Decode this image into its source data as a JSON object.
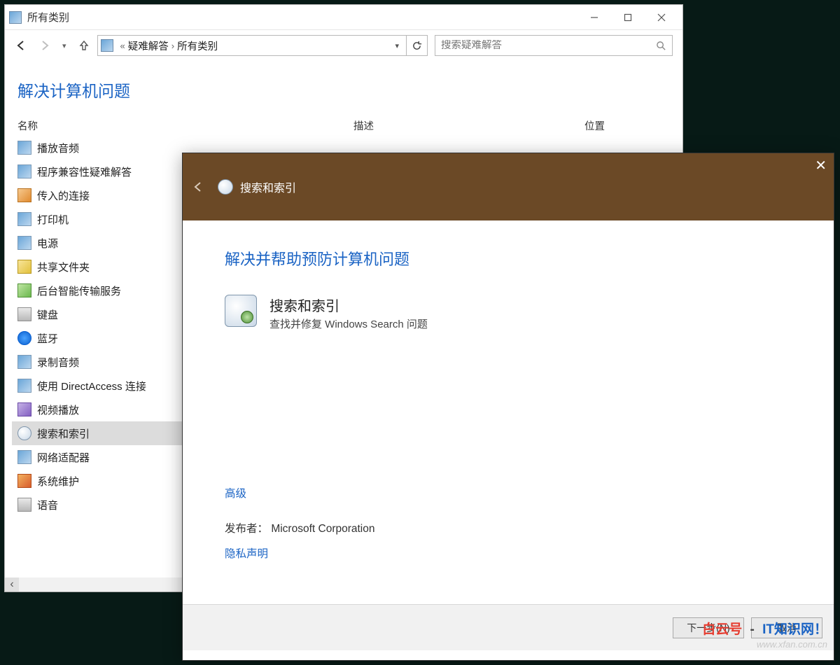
{
  "bgWindow": {
    "title": "所有类别",
    "breadcrumb": {
      "pre": "«",
      "a": "疑难解答",
      "b": "所有类别"
    },
    "searchPlaceholder": "搜索疑难解答",
    "heading": "解决计算机问题",
    "columns": {
      "name": "名称",
      "desc": "描述",
      "loc": "位置"
    },
    "items": [
      {
        "label": "播放音频",
        "iconClass": "i-blue"
      },
      {
        "label": "程序兼容性疑难解答",
        "iconClass": "i-blue"
      },
      {
        "label": "传入的连接",
        "iconClass": "i-orange"
      },
      {
        "label": "打印机",
        "iconClass": "i-blue"
      },
      {
        "label": "电源",
        "iconClass": "i-blue"
      },
      {
        "label": "共享文件夹",
        "iconClass": "i-yellow"
      },
      {
        "label": "后台智能传输服务",
        "iconClass": "i-green"
      },
      {
        "label": "键盘",
        "iconClass": "i-silver"
      },
      {
        "label": "蓝牙",
        "iconClass": "i-bt"
      },
      {
        "label": "录制音频",
        "iconClass": "i-blue"
      },
      {
        "label": "使用 DirectAccess 连接",
        "iconClass": "i-blue"
      },
      {
        "label": "视频播放",
        "iconClass": "i-purple"
      },
      {
        "label": "搜索和索引",
        "iconClass": "i-search",
        "selected": true
      },
      {
        "label": "网络适配器",
        "iconClass": "i-blue"
      },
      {
        "label": "系统维护",
        "iconClass": "i-red"
      },
      {
        "label": "语音",
        "iconClass": "i-silver"
      }
    ]
  },
  "dialog": {
    "title": "搜索和索引",
    "heading": "解决并帮助预防计算机问题",
    "tsName": "搜索和索引",
    "tsDesc": "查找并修复 Windows Search 问题",
    "advanced": "高级",
    "publisherLabel": "发布者：",
    "publisher": "Microsoft Corporation",
    "privacy": "隐私声明",
    "nextBtn": "下一步(N)",
    "cancelBtn": "取消"
  },
  "watermark": {
    "line1a": "白云号",
    "line1b": "-",
    "line1c": "IT知识网！",
    "line2": "www.xfan.com.cn"
  }
}
